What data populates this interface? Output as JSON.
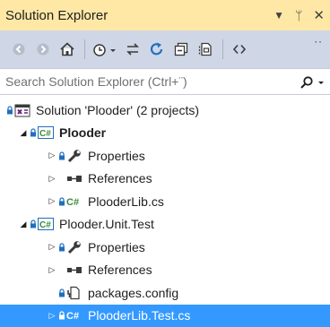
{
  "window": {
    "title": "Solution Explorer"
  },
  "search": {
    "placeholder": "Search Solution Explorer (Ctrl+¨)"
  },
  "colors": {
    "titlebar": "#ffe8a6",
    "toolbar": "#cfd6e5",
    "selection": "#3399ff",
    "csharp_green": "#3a8a3a",
    "project_blue": "#1f6fbf"
  },
  "tree": [
    {
      "label": "Solution 'Plooder' (2 projects)",
      "icon": "solution-icon"
    },
    {
      "label": "Plooder",
      "icon": "csharp-project-icon",
      "expanded": true,
      "bold": true
    },
    {
      "label": "Properties",
      "icon": "wrench-icon"
    },
    {
      "label": "References",
      "icon": "references-icon"
    },
    {
      "label": "PlooderLib.cs",
      "icon": "csharp-file-icon"
    },
    {
      "label": "Plooder.Unit.Test",
      "icon": "csharp-project-icon",
      "expanded": true
    },
    {
      "label": "Properties",
      "icon": "wrench-icon"
    },
    {
      "label": "References",
      "icon": "references-icon"
    },
    {
      "label": "packages.config",
      "icon": "config-file-icon"
    },
    {
      "label": "PlooderLib.Test.cs",
      "icon": "csharp-file-icon",
      "selected": true
    }
  ]
}
